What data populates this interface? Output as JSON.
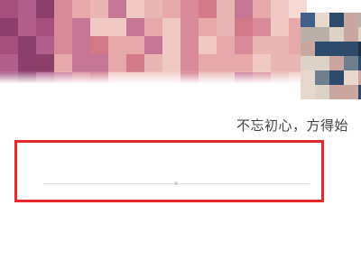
{
  "profile": {
    "motto": "不忘初心，方得始"
  },
  "colors": {
    "highlight": "#e5282b",
    "cover_tones": [
      "#b25f8c",
      "#c77796",
      "#d98a9a",
      "#e7a8aa",
      "#eab6b4",
      "#f0c9c4",
      "#8c3f6a",
      "#a44f7c",
      "#f5d9d2",
      "#d27a8a"
    ],
    "avatar_tones": [
      "#2d4a6b",
      "#c9a7a0",
      "#e8d7cc",
      "#6f7f8e",
      "#1f2f3f",
      "#b8b0a8",
      "#dcd2c8",
      "#3f5f8a"
    ]
  },
  "icons": {
    "cover": "pixelated-cover-photo",
    "avatar": "pixelated-avatar"
  }
}
